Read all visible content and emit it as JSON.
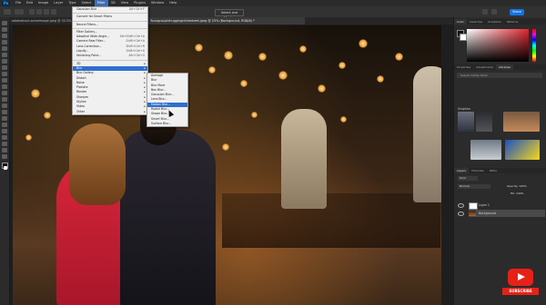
{
  "menubar": {
    "items": [
      "File",
      "Edit",
      "Image",
      "Layer",
      "Type",
      "Select",
      "Filter",
      "3D",
      "View",
      "Plugins",
      "Window",
      "Help"
    ],
    "active_index": 6
  },
  "optionsbar": {
    "select_mask": "Select and Mask...",
    "share": "Share"
  },
  "tabs": [
    {
      "label": "adobestock-someimage.jpeg @ 33.3% (RGB/8)",
      "active": false
    },
    {
      "label": "Youngcouplehugginginthestreet.jpeg @ 25% (Background, RGB/8) *",
      "active": true
    }
  ],
  "filter_menu": {
    "items": [
      {
        "label": "Gaussian Blur",
        "shortcut": "Alt+Ctrl+F"
      },
      {
        "sep": true
      },
      {
        "label": "Convert for Smart Filters"
      },
      {
        "sep": true
      },
      {
        "label": "Neural Filters..."
      },
      {
        "sep": true
      },
      {
        "label": "Filter Gallery..."
      },
      {
        "label": "Adaptive Wide Angle...",
        "shortcut": "Alt+Shift+Ctrl+A"
      },
      {
        "label": "Camera Raw Filter...",
        "shortcut": "Shift+Ctrl+A"
      },
      {
        "label": "Lens Correction...",
        "shortcut": "Shift+Ctrl+R"
      },
      {
        "label": "Liquify...",
        "shortcut": "Shift+Ctrl+X"
      },
      {
        "label": "Vanishing Point...",
        "shortcut": "Alt+Ctrl+V"
      },
      {
        "sep": true
      },
      {
        "label": "3D",
        "sub": true
      },
      {
        "label": "Blur",
        "sub": true,
        "highlight": true
      },
      {
        "label": "Blur Gallery",
        "sub": true
      },
      {
        "label": "Distort",
        "sub": true
      },
      {
        "label": "Noise",
        "sub": true
      },
      {
        "label": "Pixelate",
        "sub": true
      },
      {
        "label": "Render",
        "sub": true
      },
      {
        "label": "Sharpen",
        "sub": true
      },
      {
        "label": "Stylize",
        "sub": true
      },
      {
        "label": "Video",
        "sub": true
      },
      {
        "label": "Other",
        "sub": true
      }
    ]
  },
  "blur_submenu": {
    "items": [
      {
        "label": "Average"
      },
      {
        "label": "Blur"
      },
      {
        "label": "Blur More"
      },
      {
        "label": "Box Blur..."
      },
      {
        "label": "Gaussian Blur..."
      },
      {
        "label": "Lens Blur..."
      },
      {
        "label": "Motion Blur...",
        "highlight": true
      },
      {
        "label": "Radial Blur..."
      },
      {
        "label": "Shape Blur..."
      },
      {
        "label": "Smart Blur..."
      },
      {
        "label": "Surface Blur..."
      }
    ]
  },
  "panels": {
    "top_tabs": [
      "Color",
      "Swatches",
      "Gradients",
      "Patterns"
    ],
    "mid_tabs": [
      "Properties",
      "Adjustments",
      "Libraries"
    ],
    "library_search": "Search Adobe Stock",
    "library_name": "Graphics",
    "layer_tabs": [
      "Layers",
      "Channels",
      "Paths"
    ],
    "layer_kind": "Kind",
    "blend_mode": "Normal",
    "opacity": "Opacity: 100%",
    "fill": "Fill: 100%",
    "layers": [
      "Layer 1",
      "Background"
    ]
  },
  "subscribe": {
    "label": "SUBSCRIBE"
  },
  "colors": {
    "accent": "#1473e6",
    "highlight": "#2f6fcf",
    "youtube": "#e62117"
  }
}
